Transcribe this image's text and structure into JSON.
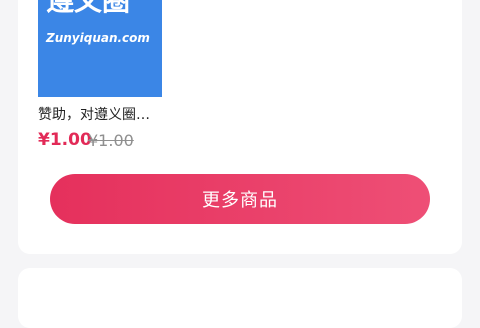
{
  "product": {
    "image_logo_text": "遵义圈",
    "image_sub_text": "Zunyiquan.com",
    "title": "赞助，对遵义圈…",
    "price": "¥1.00",
    "original_price": "¥1.00"
  },
  "actions": {
    "more_products": "更多商品"
  },
  "colors": {
    "accent": "#e5305c",
    "price": "#e22a57",
    "image_bg": "#3b86e6",
    "page_bg": "#f5f5f7"
  }
}
